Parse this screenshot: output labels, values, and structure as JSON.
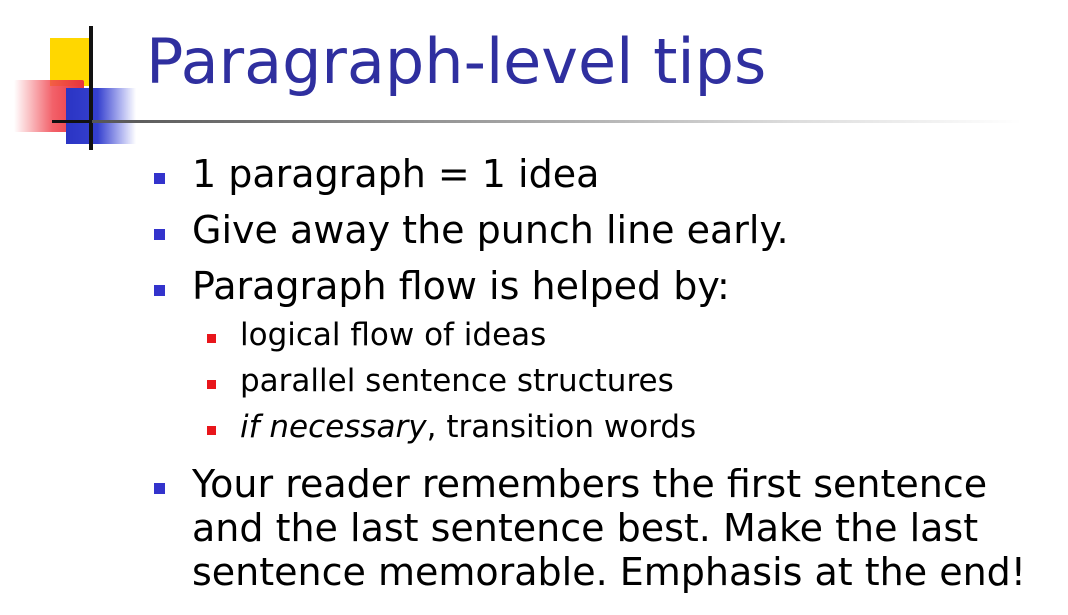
{
  "title": "Paragraph-level tips",
  "bullets": [
    {
      "text": "1 paragraph = 1 idea"
    },
    {
      "text": "Give away the punch line early."
    },
    {
      "text": "Paragraph flow is helped by:",
      "sub": [
        {
          "text": "logical flow of ideas"
        },
        {
          "text": "parallel sentence structures"
        },
        {
          "italic": "if necessary",
          "text": ", transition words"
        }
      ]
    },
    {
      "lines": [
        "Your reader remembers the first sentence",
        "and the last sentence best.  Make the last",
        "sentence memorable.  Emphasis at the end!"
      ]
    }
  ],
  "colors": {
    "title": "#2f2f9f",
    "bullet_level1": "#3333cc",
    "bullet_level2": "#e8161b",
    "logo_yellow": "#ffd700",
    "logo_red": "#e8323c",
    "logo_blue": "#2a34c4"
  }
}
